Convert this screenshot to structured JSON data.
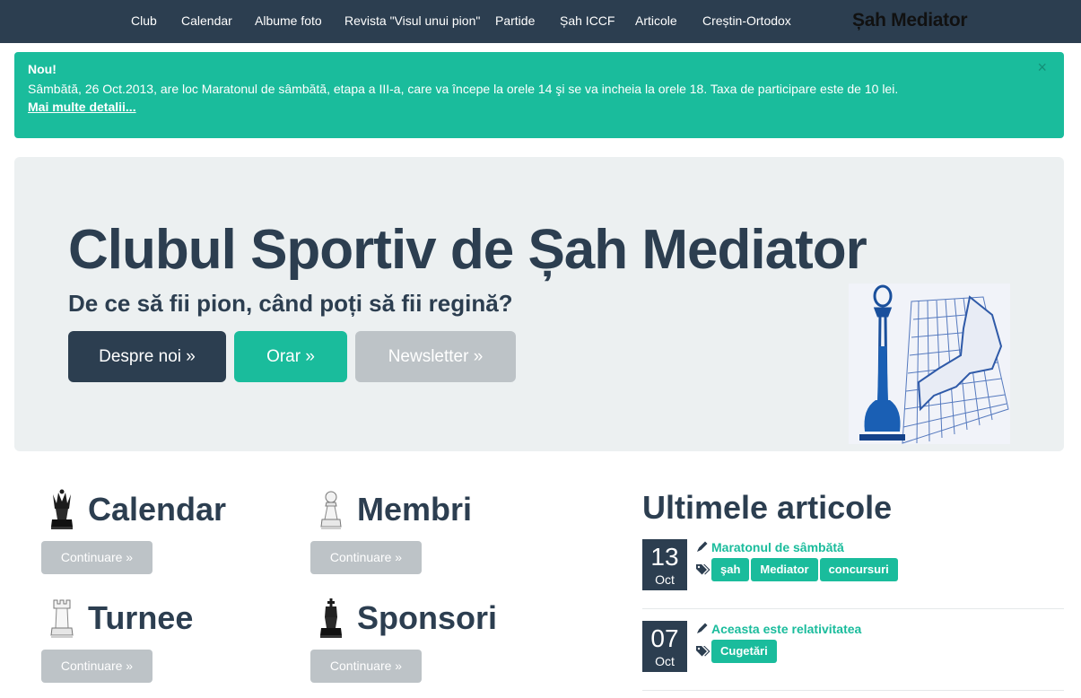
{
  "nav": {
    "items": [
      {
        "label": "Club"
      },
      {
        "label": "Calendar"
      },
      {
        "label": "Albume foto"
      },
      {
        "label": "Revista \"Visul unui pion\""
      },
      {
        "label": "Partide"
      },
      {
        "label": "Șah ICCF"
      },
      {
        "label": "Articole"
      },
      {
        "label": "Creștin-Ortodox"
      }
    ],
    "brand": "Șah Mediator"
  },
  "alert": {
    "title": "Nou!",
    "text": "Sâmbătă, 26 Oct.2013, are loc  Maratonul de sâmbătă, etapa a III-a, care va începe la orele 14 şi se va incheia la orele 18. Taxa de participare este de 10 lei.",
    "link": "Mai multe detalii...",
    "close": "×"
  },
  "jumbotron": {
    "title": "Clubul Sportiv de Șah Mediator",
    "subtitle": "De ce să fii pion, când poți să fii regină?",
    "buttons": [
      "Despre noi »",
      "Orar »",
      "Newsletter »"
    ]
  },
  "features": [
    {
      "title": "Calendar",
      "button": "Continuare »",
      "icon": "black-queen-icon"
    },
    {
      "title": "Membri",
      "button": "Continuare »",
      "icon": "white-pawn-icon"
    },
    {
      "title": "Turnee",
      "button": "Continuare »",
      "icon": "white-rook-icon"
    },
    {
      "title": "Sponsori",
      "button": "Continuare »",
      "icon": "black-king-icon"
    }
  ],
  "articles": {
    "heading": "Ultimele articole",
    "items": [
      {
        "day": "13",
        "month": "Oct",
        "title": "Maratonul de sâmbătă",
        "tags": [
          "şah",
          "Mediator",
          "concursuri"
        ]
      },
      {
        "day": "07",
        "month": "Oct",
        "title": "Aceasta este relativitatea",
        "tags": [
          "Cugetări"
        ]
      }
    ]
  },
  "colors": {
    "navbar": "#2c3e50",
    "accent": "#1abc9c",
    "jumbotron": "#ecf0f1",
    "muted_button": "#bdc3c7"
  }
}
